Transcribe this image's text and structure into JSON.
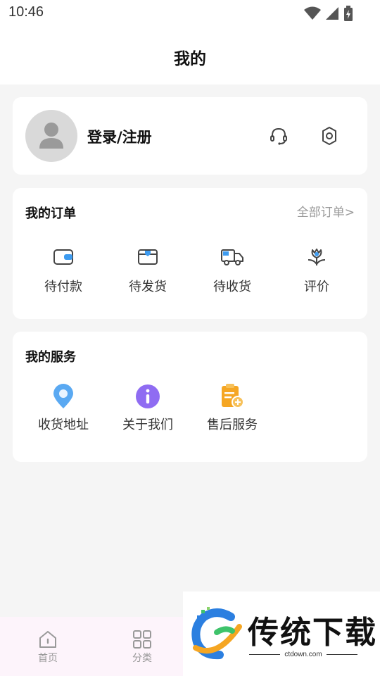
{
  "status_bar": {
    "time": "10:46"
  },
  "header": {
    "title": "我的"
  },
  "profile": {
    "login_label": "登录/注册"
  },
  "orders": {
    "title": "我的订单",
    "all_link": "全部订单>",
    "items": [
      {
        "label": "待付款",
        "icon": "wallet-icon"
      },
      {
        "label": "待发货",
        "icon": "package-icon"
      },
      {
        "label": "待收货",
        "icon": "truck-icon"
      },
      {
        "label": "评价",
        "icon": "flower-icon"
      }
    ]
  },
  "services": {
    "title": "我的服务",
    "items": [
      {
        "label": "收货地址",
        "icon": "location-pin-icon"
      },
      {
        "label": "关于我们",
        "icon": "info-icon"
      },
      {
        "label": "售后服务",
        "icon": "after-sales-icon"
      }
    ]
  },
  "bottom_nav": {
    "items": [
      {
        "label": "首页",
        "icon": "home-icon"
      },
      {
        "label": "分类",
        "icon": "grid-icon"
      }
    ]
  },
  "watermark": {
    "brand": "传统下载",
    "url": "ctdown.com"
  },
  "colors": {
    "accent_blue": "#3d9bf0",
    "accent_purple": "#8f6cf2",
    "accent_orange": "#f5a623",
    "nav_bg": "#fdf4fb"
  }
}
